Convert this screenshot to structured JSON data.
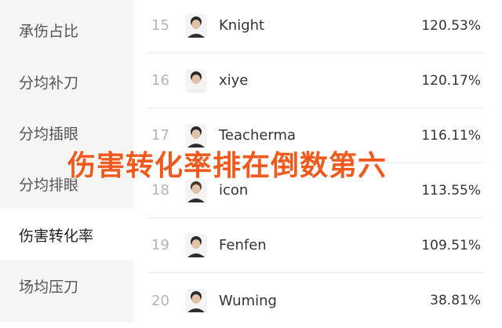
{
  "sidebar": {
    "items": [
      {
        "label": "承伤占比",
        "active": false
      },
      {
        "label": "分均补刀",
        "active": false
      },
      {
        "label": "分均插眼",
        "active": false
      },
      {
        "label": "分均排眼",
        "active": false
      },
      {
        "label": "伤害转化率",
        "active": true
      },
      {
        "label": "场均压刀",
        "active": false
      }
    ]
  },
  "ranking": {
    "rows": [
      {
        "rank": "15",
        "name": "Knight",
        "value": "120.53%",
        "avatar_icon": "player-avatar-icon"
      },
      {
        "rank": "16",
        "name": "xiye",
        "value": "120.17%",
        "avatar_icon": "player-avatar-icon"
      },
      {
        "rank": "17",
        "name": "Teacherma",
        "value": "116.11%",
        "avatar_icon": "player-avatar-icon"
      },
      {
        "rank": "18",
        "name": "icon",
        "value": "113.55%",
        "avatar_icon": "player-avatar-icon"
      },
      {
        "rank": "19",
        "name": "Fenfen",
        "value": "109.51%",
        "avatar_icon": "player-avatar-icon"
      },
      {
        "rank": "20",
        "name": "Wuming",
        "value": "38.81%",
        "avatar_icon": "player-avatar-icon"
      }
    ]
  },
  "overlay": {
    "caption": "伤害转化率排在倒数第六"
  },
  "colors": {
    "sidebar_bg": "#f5f5f5",
    "caption": "#f05a1e",
    "rank_number": "#b5b5b5",
    "divider": "#ececec"
  }
}
